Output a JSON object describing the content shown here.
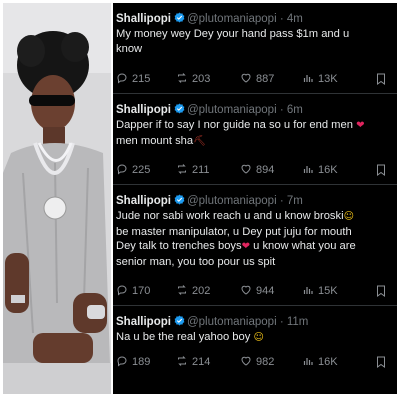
{
  "brand": {
    "verified_color": "#1d9bf0",
    "background": "#000000",
    "text": "#e7e9ea",
    "muted": "#71767b"
  },
  "tweets": [
    {
      "name": "Shallipopi",
      "handle_time": "@plutomaniapopi · 4m",
      "lines": [
        "My money wey Dey your hand pass $1m and u",
        "know"
      ],
      "stats": {
        "replies": "215",
        "reposts": "203",
        "likes": "887",
        "views": "13K"
      }
    },
    {
      "name": "Shallipopi",
      "handle_time": "@plutomaniapopi · 6m",
      "lines": [
        "Dapper if to say I nor guide na so u for end men ",
        "men mount sha"
      ],
      "emojis": [
        "❤",
        "⛏"
      ],
      "stats": {
        "replies": "225",
        "reposts": "211",
        "likes": "894",
        "views": "16K"
      }
    },
    {
      "name": "Shallipopi",
      "handle_time": "@plutomaniapopi · 7m",
      "lines": [
        "Jude nor sabi work reach u and u know broski",
        "be master manipulator, u Dey put juju for mouth",
        "Dey talk to trenches boys",
        " u know what you are",
        "senior man, you too pour us spit"
      ],
      "emojis": [
        "☺",
        "❤"
      ],
      "stats": {
        "replies": "170",
        "reposts": "202",
        "likes": "944",
        "views": "15K"
      }
    },
    {
      "name": "Shallipopi",
      "handle_time": "@plutomaniapopi · 11m",
      "lines": [
        "Na u be the real yahoo boy "
      ],
      "emojis": [
        "☺"
      ],
      "stats": {
        "replies": "189",
        "reposts": "214",
        "likes": "982",
        "views": "16K"
      }
    }
  ],
  "icons": [
    "reply-icon",
    "repost-icon",
    "like-icon",
    "views-icon",
    "bookmark-icon",
    "verified-badge-icon"
  ]
}
